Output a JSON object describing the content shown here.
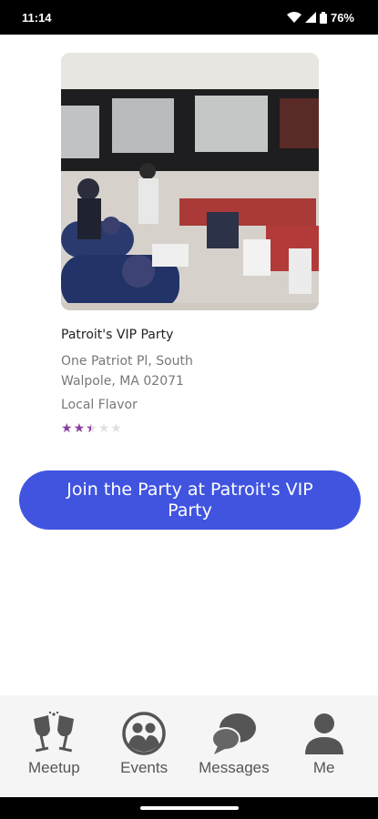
{
  "status_bar": {
    "time": "11:14",
    "battery": "76%",
    "icons": [
      "wifi-icon",
      "signal-icon",
      "battery-icon"
    ]
  },
  "venue": {
    "photo_description_icon": "party-hall-photo",
    "name": "Patroit's VIP Party",
    "address": "One Patriot Pl, South Walpole, MA 02071",
    "category": "Local Flavor",
    "rating": 2.5,
    "rating_max": 5
  },
  "cta": {
    "label": "Join the Party at Patroit's VIP Party",
    "color": "#4054e0"
  },
  "bottom_nav": {
    "items": [
      {
        "label": "Meetup",
        "icon": "toast-glasses-icon"
      },
      {
        "label": "Events",
        "icon": "people-icon"
      },
      {
        "label": "Messages",
        "icon": "chat-bubbles-icon"
      },
      {
        "label": "Me",
        "icon": "person-icon"
      }
    ]
  },
  "colors": {
    "accent": "#4054e0",
    "star": "#8b3f9f",
    "nav_icon": "#555555"
  }
}
